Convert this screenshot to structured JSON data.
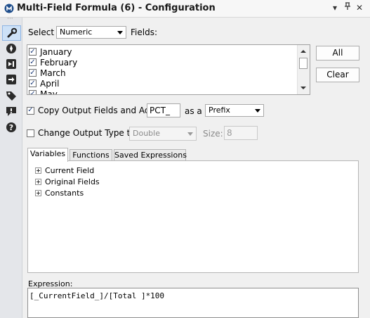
{
  "window": {
    "title": "Multi-Field Formula (6) - Configuration",
    "controls": {
      "menu": "▾",
      "pin": "ᵽ",
      "close": "✕"
    }
  },
  "toolstrip": {
    "items": [
      {
        "name": "configuration",
        "icon": "wrench-icon",
        "active": true
      },
      {
        "name": "layout",
        "icon": "compass-icon"
      },
      {
        "name": "input",
        "icon": "input-anchor-icon"
      },
      {
        "name": "output",
        "icon": "output-anchor-icon"
      },
      {
        "name": "annotation",
        "icon": "tag-icon"
      },
      {
        "name": "errors",
        "icon": "alert-icon"
      },
      {
        "name": "help",
        "icon": "help-icon"
      }
    ]
  },
  "select": {
    "label": "Select",
    "type_value": "Numeric",
    "fields_label": "Fields:"
  },
  "fields": {
    "items": [
      {
        "label": "January",
        "checked": true
      },
      {
        "label": "February",
        "checked": true
      },
      {
        "label": "March",
        "checked": true
      },
      {
        "label": "April",
        "checked": true
      },
      {
        "label": "May",
        "checked": true
      }
    ],
    "all_label": "All",
    "clear_label": "Clear"
  },
  "copy_output": {
    "checked": true,
    "label": "Copy Output Fields and Add",
    "affix_value": "PCT_",
    "as_a_label": "as a",
    "position_value": "Prefix"
  },
  "change_type": {
    "checked": false,
    "label": "Change Output Type to",
    "type_value": "Double",
    "size_label": "Size:",
    "size_value": "8"
  },
  "tabs": [
    {
      "label": "Variables",
      "active": true
    },
    {
      "label": "Functions",
      "active": false
    },
    {
      "label": "Saved Expressions",
      "active": false
    }
  ],
  "variables_tree": [
    {
      "label": "Current Field"
    },
    {
      "label": "Original Fields"
    },
    {
      "label": "Constants"
    }
  ],
  "expression": {
    "label": "Expression:",
    "value": "[_CurrentField_]/[Total ]*100"
  }
}
